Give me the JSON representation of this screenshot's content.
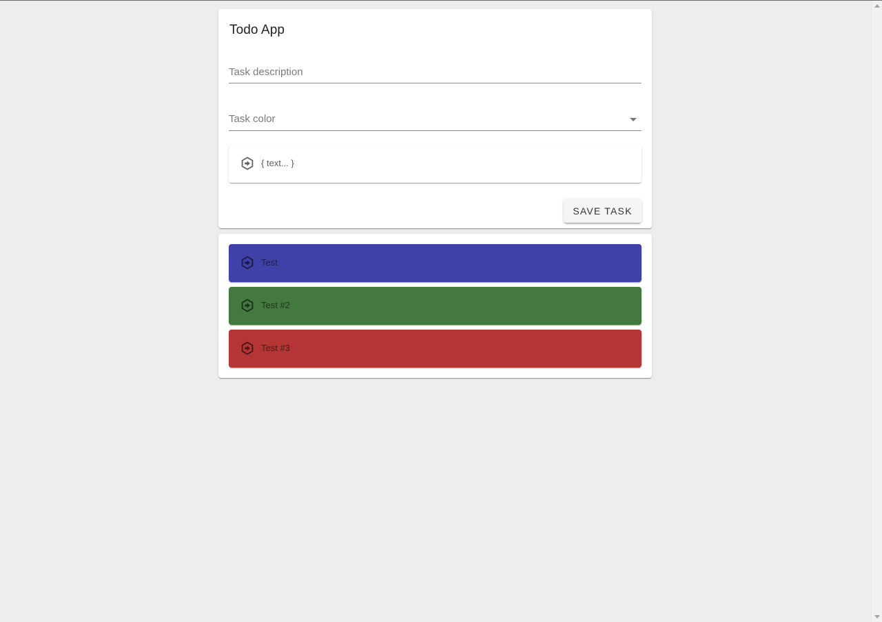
{
  "app": {
    "title": "Todo App"
  },
  "form": {
    "description": {
      "placeholder": "Task description",
      "value": ""
    },
    "color": {
      "label": "Task color",
      "selected": ""
    },
    "preview": {
      "text": "{ text... }",
      "icon": "hexagon-arrow-icon",
      "color": "#ffffff"
    },
    "save_label": "SAVE TASK"
  },
  "tasks": [
    {
      "text": "Test",
      "color": "#3f41a9",
      "icon": "hexagon-arrow-icon"
    },
    {
      "text": "Test #2",
      "color": "#43783f",
      "icon": "hexagon-arrow-icon"
    },
    {
      "text": "Test #3",
      "color": "#b53435",
      "icon": "hexagon-arrow-icon"
    }
  ],
  "colors": {
    "background": "#ededed",
    "card": "#ffffff"
  }
}
